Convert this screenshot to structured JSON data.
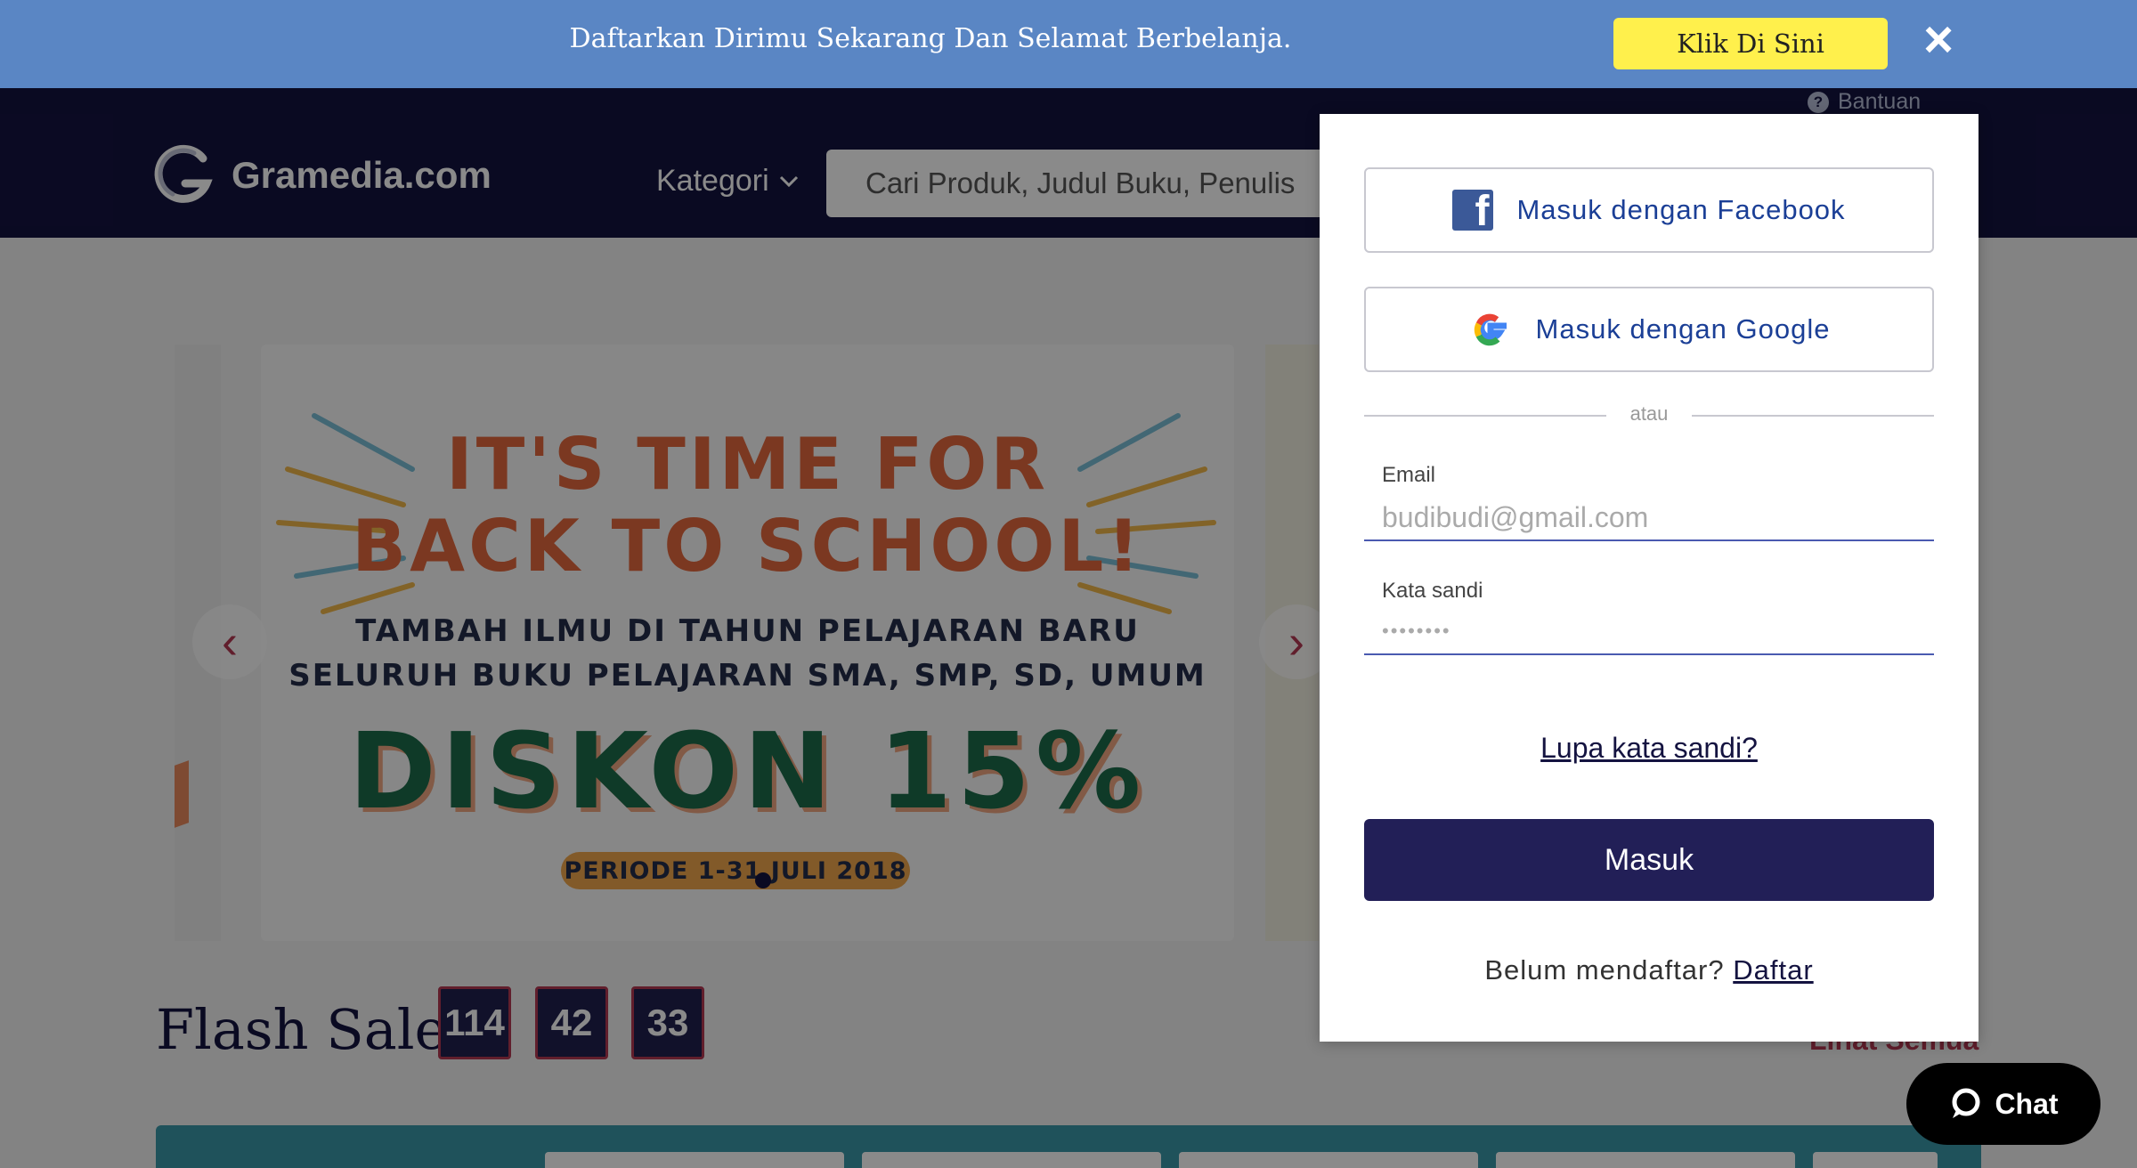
{
  "promo": {
    "message": "Daftarkan Dirimu Sekarang Dan Selamat Berbelanja.",
    "cta_label": "Klik Di Sini",
    "close_icon": "×"
  },
  "header": {
    "help_label": "Bantuan",
    "brand": "Gramedia.com",
    "category_label": "Kategori",
    "search_placeholder": "Cari Produk, Judul Buku, Penulis"
  },
  "banner": {
    "line1": "IT'S TIME FOR",
    "line2": "BACK TO SCHOOL!",
    "line3": "TAMBAH ILMU DI TAHUN PELAJARAN BARU",
    "line4": "SELURUH BUKU PELAJARAN SMA, SMP, SD, UMUM",
    "line5": "DISKON 15%",
    "line6": "PERIODE 1-31 JULI 2018",
    "prev_icon": "‹",
    "next_icon": "›"
  },
  "flash_sale": {
    "title": "Flash Sale",
    "timer": [
      "114",
      "42",
      "33"
    ],
    "see_all": "Lihat Semua"
  },
  "chat": {
    "label": "Chat"
  },
  "login": {
    "facebook_label": "Masuk dengan Facebook",
    "google_label": "Masuk dengan Google",
    "divider": "atau",
    "email_label": "Email",
    "email_placeholder": "budibudi@gmail.com",
    "password_label": "Kata sandi",
    "password_placeholder": "••••••••",
    "forgot_label": "Lupa kata sandi?",
    "submit_label": "Masuk",
    "register_prompt": "Belum mendaftar?",
    "register_link": "Daftar"
  },
  "colors": {
    "promo_bg": "#5a86c4",
    "header_bg": "#141340",
    "cta_bg": "#fff04c",
    "submit_bg": "#221f57",
    "accent": "#b43852"
  }
}
